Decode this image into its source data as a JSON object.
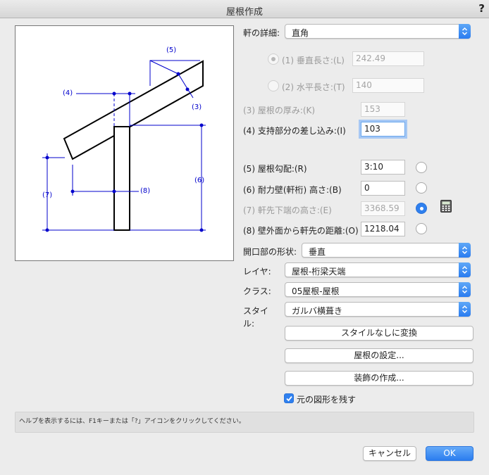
{
  "window": {
    "title": "屋根作成",
    "help_label": "?"
  },
  "diagram": {
    "labels": {
      "l5": "(5)",
      "l4": "(4)",
      "l3": "(3)",
      "l6": "(6)",
      "l7": "(7)",
      "l8": "(8)"
    },
    "line_color": "#0000cc"
  },
  "eave_detail": {
    "label": "軒の詳細:",
    "value": "直角"
  },
  "vertical_length": {
    "label": "(1) 垂直長さ:(L)",
    "value": "242.49"
  },
  "horizontal_length": {
    "label": "(2) 水平長さ:(T)",
    "value": "140"
  },
  "roof_thickness": {
    "label": "(3) 屋根の厚み:(K)",
    "value": "153"
  },
  "support_insert": {
    "label": "(4) 支持部分の差し込み:(I)",
    "value": "103"
  },
  "roof_pitch": {
    "label": "(5) 屋根勾配:(R)",
    "value": "3:10"
  },
  "bearing_wall_height": {
    "label": "(6) 耐力壁(軒桁) 高さ:(B)",
    "value": "0"
  },
  "eave_bottom_height": {
    "label": "(7) 軒先下端の高さ:(E)",
    "value": "3368.59"
  },
  "wall_to_eave_distance": {
    "label": "(8) 壁外面から軒先の距離:(O)",
    "value": "1218.04"
  },
  "opening_shape": {
    "label": "開口部の形状:",
    "value": "垂直"
  },
  "layer": {
    "label": "レイヤ:",
    "value": "屋根-桁梁天端"
  },
  "class": {
    "label": "クラス:",
    "value": "05屋根-屋根"
  },
  "style": {
    "label_line1": "スタイ",
    "label_line2": "ル:",
    "value": "ガルバ横葺き"
  },
  "buttons": {
    "convert_unstyled": "スタイルなしに変換",
    "roof_settings": "屋根の設定...",
    "create_trim": "装飾の作成...",
    "cancel": "キャンセル",
    "ok": "OK"
  },
  "keep_original": {
    "label": "元の図形を残す",
    "checked": true
  },
  "help_text": "ヘルプを表示するには、F1キーまたは「?」アイコンをクリックしてください。",
  "colors": {
    "accent": "#2f80ef"
  }
}
